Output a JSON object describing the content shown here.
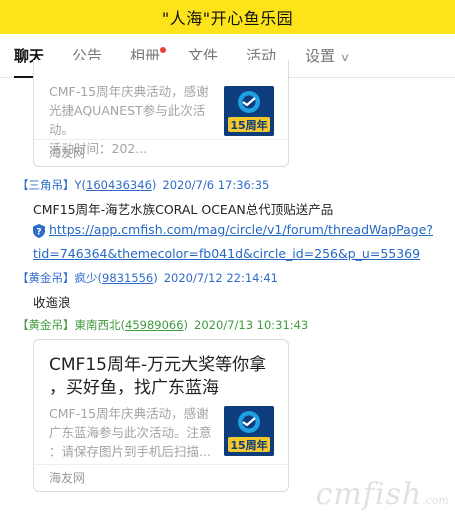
{
  "window": {
    "title": "\"人海\"开心鱼乐园"
  },
  "tabs": [
    {
      "label": "聊天",
      "active": true
    },
    {
      "label": "公告"
    },
    {
      "label": "相册",
      "has_dot": true
    },
    {
      "label": "文件"
    },
    {
      "label": "活动"
    },
    {
      "label": "设置",
      "chevron": "chevron-down-icon"
    }
  ],
  "cards": [
    {
      "desc_lines": [
        "CMF-15周年庆典活动，感谢",
        "光捷AQUANEST参与此次活动。",
        "活动时间：202..."
      ],
      "footer": "海友网",
      "thumb_text": "15周年"
    },
    {
      "title_lines": [
        "CMF15周年-万元大奖等你拿",
        "，买好鱼，找广东蓝海"
      ],
      "desc_lines": [
        "CMF-15周年庆典活动，感谢",
        "广东蓝海参与此次活动。注意",
        "：请保存图片到手机后扫描..."
      ],
      "footer": "海友网",
      "thumb_text": "15周年"
    }
  ],
  "messages": [
    {
      "badge": "【三角吊】",
      "sender": "Y",
      "uid": "160436346",
      "time": "2020/7/6 17:36:35",
      "text": "CMF15周年-海艺水族CORAL OCEAN总代顶贴送产品",
      "link_lines": [
        "https://app.cmfish.com/mag/circle/v1/forum/threadWapPage?",
        "tid=746364&themecolor=fb041d&circle_id=256&p_u=55369"
      ]
    },
    {
      "badge": "【黄金吊】",
      "sender": "疯少",
      "uid": "9831556",
      "time": "2020/7/12 22:14:41",
      "text": "收迤浪"
    },
    {
      "badge": "【黄金吊】",
      "sender": "東南西北",
      "uid": "45989066",
      "time": "2020/7/13 10:31:43"
    }
  ],
  "watermark": {
    "main": "cmfish",
    "suffix": ".com"
  },
  "colors": {
    "titlebar": "#fde41a",
    "link": "#2568c4",
    "badge_blue": "#2f6bc9",
    "badge_green": "#3f9a3c"
  }
}
